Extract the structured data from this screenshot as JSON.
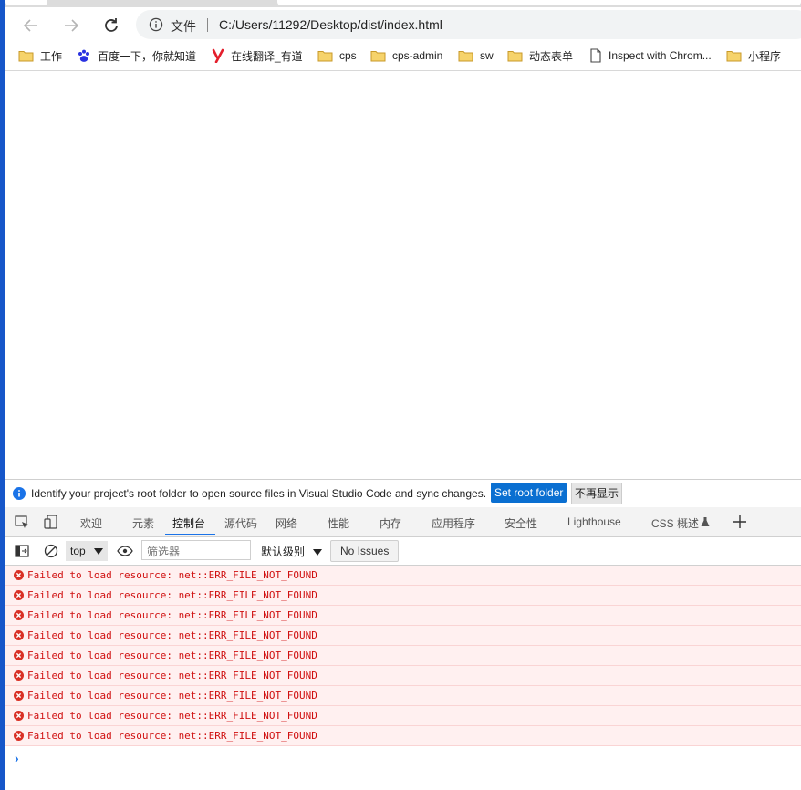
{
  "browser": {
    "address_label": "文件",
    "url": "C:/Users/11292/Desktop/dist/index.html"
  },
  "bookmarks": [
    {
      "label": "工作",
      "icon": "folder-icon"
    },
    {
      "label": "百度一下，你就知道",
      "icon": "baidu-icon"
    },
    {
      "label": "在线翻译_有道",
      "icon": "youdao-icon"
    },
    {
      "label": "cps",
      "icon": "folder-icon"
    },
    {
      "label": "cps-admin",
      "icon": "folder-icon"
    },
    {
      "label": "sw",
      "icon": "folder-icon"
    },
    {
      "label": "动态表单",
      "icon": "folder-icon"
    },
    {
      "label": "Inspect with Chrom...",
      "icon": "page-icon"
    },
    {
      "label": "小程序",
      "icon": "folder-icon"
    }
  ],
  "infobar": {
    "message": "Identify your project's root folder to open source files in Visual Studio Code and sync changes.",
    "set_root_label": "Set root folder",
    "dismiss_label": "不再显示"
  },
  "devtools": {
    "tabs": [
      "欢迎",
      "元素",
      "控制台",
      "源代码",
      "网络",
      "性能",
      "内存",
      "应用程序",
      "安全性",
      "Lighthouse",
      "CSS 概述"
    ],
    "active_tab": "控制台"
  },
  "console_toolbar": {
    "context": "top",
    "filter_placeholder": "筛选器",
    "levels_label": "默认级别",
    "issues_label": "No Issues"
  },
  "console_messages": [
    "Failed to load resource: net::ERR_FILE_NOT_FOUND",
    "Failed to load resource: net::ERR_FILE_NOT_FOUND",
    "Failed to load resource: net::ERR_FILE_NOT_FOUND",
    "Failed to load resource: net::ERR_FILE_NOT_FOUND",
    "Failed to load resource: net::ERR_FILE_NOT_FOUND",
    "Failed to load resource: net::ERR_FILE_NOT_FOUND",
    "Failed to load resource: net::ERR_FILE_NOT_FOUND",
    "Failed to load resource: net::ERR_FILE_NOT_FOUND",
    "Failed to load resource: net::ERR_FILE_NOT_FOUND"
  ],
  "colors": {
    "accent": "#1a73e8",
    "set_root_bg": "#0a6fd1",
    "error_text": "#d01010",
    "error_bg": "#fff0f0",
    "window_edge": "#1656c9"
  }
}
